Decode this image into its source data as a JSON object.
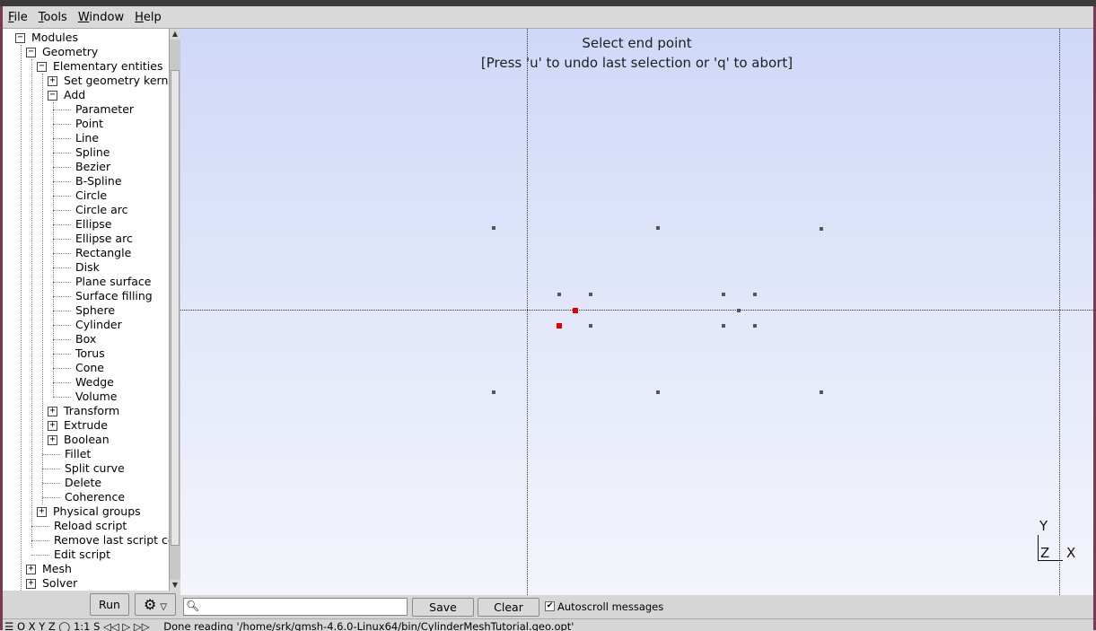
{
  "menubar": {
    "file": {
      "key": "F",
      "rest": "ile"
    },
    "tools": {
      "key": "T",
      "rest": "ools"
    },
    "window": {
      "key": "W",
      "rest": "indow"
    },
    "help": {
      "key": "H",
      "rest": "elp"
    }
  },
  "tree": {
    "modules": "Modules",
    "geometry": "Geometry",
    "elementary": "Elementary entities",
    "set_kernel": "Set geometry kern",
    "add": "Add",
    "add_items": [
      "Parameter",
      "Point",
      "Line",
      "Spline",
      "Bezier",
      "B-Spline",
      "Circle",
      "Circle arc",
      "Ellipse",
      "Ellipse arc",
      "Rectangle",
      "Disk",
      "Plane surface",
      "Surface filling",
      "Sphere",
      "Cylinder",
      "Box",
      "Torus",
      "Cone",
      "Wedge",
      "Volume"
    ],
    "transform": "Transform",
    "extrude": "Extrude",
    "boolean": "Boolean",
    "fillet": "Fillet",
    "split_curve": "Split curve",
    "delete": "Delete",
    "coherence": "Coherence",
    "physical_groups": "Physical groups",
    "reload_script": "Reload script",
    "remove_last": "Remove last script cc",
    "edit_script": "Edit script",
    "mesh": "Mesh",
    "solver": "Solver"
  },
  "left_buttons": {
    "run": "Run",
    "gear": "⚙",
    "gear_arrow": "▽"
  },
  "viewport": {
    "prompt_line1": "Select end point",
    "prompt_line2": "[Press 'u' to undo last selection or 'q' to abort]",
    "axis_y": "Y",
    "axis_z": "Z",
    "axis_x": "X"
  },
  "bottom": {
    "search_placeholder": "",
    "save": "Save",
    "clear": "Clear",
    "autoscroll_check": "✔",
    "autoscroll_label": "Autoscroll messages"
  },
  "status": {
    "left": "☰ O X Y Z ◯ 1:1 S  ◁◁ ▷ ▷▷",
    "message": "Done reading '/home/srk/gmsh-4.6.0-Linux64/bin/CylinderMeshTutorial.geo.opt'"
  },
  "colors": {
    "selected_point": "#e00000",
    "point": "#555555"
  }
}
